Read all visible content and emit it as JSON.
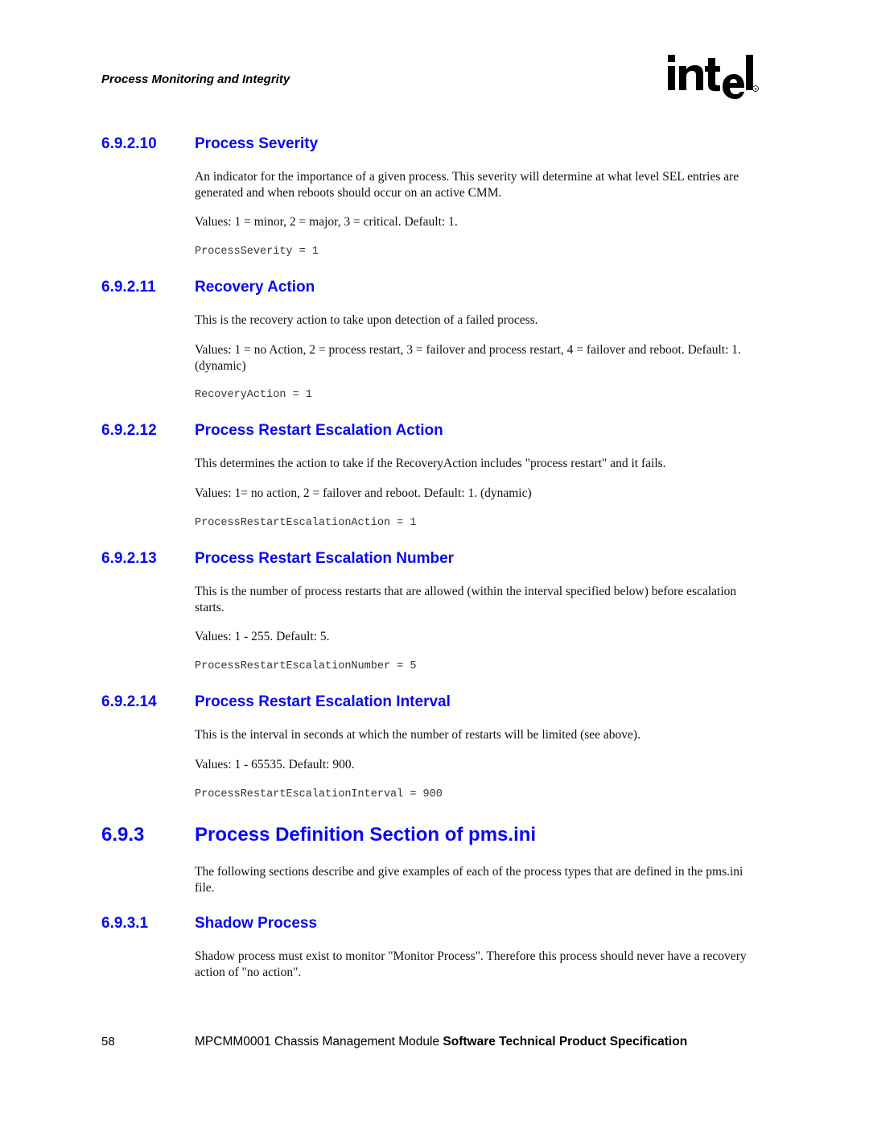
{
  "header": {
    "running_title": "Process Monitoring and Integrity",
    "logo": {
      "text": "intel",
      "registered": "®",
      "icon": "intel-logo"
    }
  },
  "sections": [
    {
      "number": "6.9.2.10",
      "title": "Process Severity",
      "description": "An indicator for the importance of a given process. This severity will determine at what level SEL entries are generated and when reboots should occur on an active CMM.",
      "values": "Values: 1 = minor, 2 = major, 3 = critical. Default: 1.",
      "code": "ProcessSeverity = 1"
    },
    {
      "number": "6.9.2.11",
      "title": "Recovery Action",
      "description": "This is the recovery action to take upon detection of a failed process.",
      "values": "Values: 1 = no Action, 2 = process restart, 3 = failover and process restart, 4 = failover and reboot. Default: 1. (dynamic)",
      "code": "RecoveryAction = 1"
    },
    {
      "number": "6.9.2.12",
      "title": "Process Restart Escalation Action",
      "description": "This determines the action to take if the RecoveryAction includes \"process restart\" and it fails.",
      "values": "Values: 1= no action, 2 = failover and reboot. Default: 1. (dynamic)",
      "code": "ProcessRestartEscalationAction = 1"
    },
    {
      "number": "6.9.2.13",
      "title": "Process Restart Escalation Number",
      "description": "This is the number of process restarts that are allowed (within the interval specified below) before escalation starts.",
      "values": "Values: 1 - 255. Default: 5.",
      "code": "ProcessRestartEscalationNumber = 5"
    },
    {
      "number": "6.9.2.14",
      "title": "Process Restart Escalation Interval",
      "description": "This is the interval in seconds at which the number of restarts will be limited (see above).",
      "values": "Values: 1 - 65535. Default: 900.",
      "code": "ProcessRestartEscalationInterval = 900"
    }
  ],
  "major_section": {
    "number": "6.9.3",
    "title": "Process Definition Section of pms.ini",
    "description": "The following sections describe and give examples of each of the process types that are defined in the pms.ini file."
  },
  "subsection": {
    "number": "6.9.3.1",
    "title": "Shadow Process",
    "description": "Shadow process must exist to monitor \"Monitor Process\". Therefore this process should never have a recovery action of \"no action\"."
  },
  "footer": {
    "page_number": "58",
    "title_regular": "MPCMM0001 Chassis Management Module ",
    "title_bold": "Software Technical Product Specification"
  },
  "colors": {
    "heading": "#0a0af0",
    "body_text": "#111111",
    "code_text": "#333333"
  }
}
